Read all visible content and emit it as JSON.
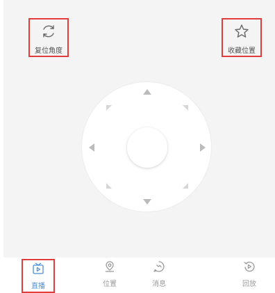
{
  "colors": {
    "accent": "#4a8fd8",
    "highlight_border": "#e23b3b",
    "background": "#f4f4f4",
    "inactive": "#9a9a9a"
  },
  "top": {
    "reset_label": "复位角度",
    "reset_icon": "rotate-icon",
    "favorite_label": "收藏位置",
    "favorite_icon": "star-icon"
  },
  "ptz": {
    "directions": [
      "up",
      "down",
      "left",
      "right",
      "up-left",
      "up-right",
      "down-left",
      "down-right"
    ]
  },
  "tabs": [
    {
      "label": "直播",
      "icon": "live-tv-icon",
      "active": true
    },
    {
      "label": "位置",
      "icon": "location-pin-icon",
      "active": false
    },
    {
      "label": "消息",
      "icon": "message-icon",
      "active": false
    },
    {
      "label": "回放",
      "icon": "playback-icon",
      "active": false
    }
  ]
}
